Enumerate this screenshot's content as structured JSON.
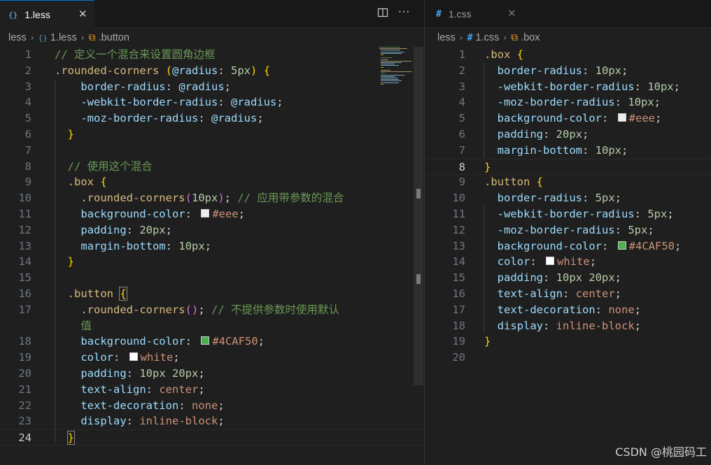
{
  "left": {
    "tab": {
      "icon": "{}",
      "label": "1.less",
      "close": "✕"
    },
    "actions": {
      "split": "split-editor-icon",
      "more": "···"
    },
    "breadcrumb": {
      "file": "less",
      "file2": "1.less",
      "symbol": ".button"
    },
    "current_line": 24,
    "lines": [
      {
        "n": "1",
        "t": [
          [
            "c-comment",
            "// 定义一个混合来设置圆角边框"
          ]
        ]
      },
      {
        "n": "2",
        "t": [
          [
            "c-sel",
            ".rounded-corners"
          ],
          [
            "c-txt",
            " "
          ],
          [
            "c-b1",
            "("
          ],
          [
            "c-var",
            "@radius"
          ],
          [
            "c-txt",
            ": "
          ],
          [
            "c-num",
            "5px"
          ],
          [
            "c-b1",
            ")"
          ],
          [
            "c-txt",
            " "
          ],
          [
            "c-b1",
            "{"
          ]
        ]
      },
      {
        "n": "3",
        "t": [
          [
            "c-txt",
            "    "
          ],
          [
            "c-prop",
            "border-radius"
          ],
          [
            "c-txt",
            ": "
          ],
          [
            "c-var",
            "@radius"
          ],
          [
            "c-txt",
            ";"
          ]
        ]
      },
      {
        "n": "4",
        "t": [
          [
            "c-txt",
            "    "
          ],
          [
            "c-prop",
            "-webkit-border-radius"
          ],
          [
            "c-txt",
            ": "
          ],
          [
            "c-var",
            "@radius"
          ],
          [
            "c-txt",
            ";"
          ]
        ]
      },
      {
        "n": "5",
        "t": [
          [
            "c-txt",
            "    "
          ],
          [
            "c-prop",
            "-moz-border-radius"
          ],
          [
            "c-txt",
            ": "
          ],
          [
            "c-var",
            "@radius"
          ],
          [
            "c-txt",
            ";"
          ]
        ]
      },
      {
        "n": "6",
        "t": [
          [
            "c-txt",
            "  "
          ],
          [
            "c-b1",
            "}"
          ]
        ]
      },
      {
        "n": "7",
        "t": []
      },
      {
        "n": "8",
        "t": [
          [
            "c-txt",
            "  "
          ],
          [
            "c-comment",
            "// 使用这个混合"
          ]
        ]
      },
      {
        "n": "9",
        "t": [
          [
            "c-txt",
            "  "
          ],
          [
            "c-sel",
            ".box"
          ],
          [
            "c-txt",
            " "
          ],
          [
            "c-b1",
            "{"
          ]
        ]
      },
      {
        "n": "10",
        "t": [
          [
            "c-txt",
            "    "
          ],
          [
            "c-sel",
            ".rounded-corners"
          ],
          [
            "c-b2",
            "("
          ],
          [
            "c-num",
            "10px"
          ],
          [
            "c-b2",
            ")"
          ],
          [
            "c-txt",
            "; "
          ],
          [
            "c-comment",
            "// 应用带参数的混合"
          ]
        ]
      },
      {
        "n": "11",
        "t": [
          [
            "c-txt",
            "    "
          ],
          [
            "c-prop",
            "background-color"
          ],
          [
            "c-txt",
            ": "
          ],
          [
            "swatch",
            "#eeeeee"
          ],
          [
            "c-str",
            "#eee"
          ],
          [
            "c-txt",
            ";"
          ]
        ]
      },
      {
        "n": "12",
        "t": [
          [
            "c-txt",
            "    "
          ],
          [
            "c-prop",
            "padding"
          ],
          [
            "c-txt",
            ": "
          ],
          [
            "c-num",
            "20px"
          ],
          [
            "c-txt",
            ";"
          ]
        ]
      },
      {
        "n": "13",
        "t": [
          [
            "c-txt",
            "    "
          ],
          [
            "c-prop",
            "margin-bottom"
          ],
          [
            "c-txt",
            ": "
          ],
          [
            "c-num",
            "10px"
          ],
          [
            "c-txt",
            ";"
          ]
        ]
      },
      {
        "n": "14",
        "t": [
          [
            "c-txt",
            "  "
          ],
          [
            "c-b1",
            "}"
          ]
        ]
      },
      {
        "n": "15",
        "t": []
      },
      {
        "n": "16",
        "t": [
          [
            "c-txt",
            "  "
          ],
          [
            "c-sel",
            ".button"
          ],
          [
            "c-txt",
            " "
          ],
          [
            "c-b1 bracket-match",
            "{"
          ]
        ]
      },
      {
        "n": "17",
        "t": [
          [
            "c-txt",
            "    "
          ],
          [
            "c-sel",
            ".rounded-corners"
          ],
          [
            "c-b2",
            "()"
          ],
          [
            "c-txt",
            "; "
          ],
          [
            "c-comment",
            "// 不提供参数时使用默认"
          ]
        ]
      },
      {
        "n": "",
        "t": [
          [
            "c-txt",
            "    "
          ],
          [
            "c-comment",
            "值"
          ]
        ]
      },
      {
        "n": "18",
        "t": [
          [
            "c-txt",
            "    "
          ],
          [
            "c-prop",
            "background-color"
          ],
          [
            "c-txt",
            ": "
          ],
          [
            "swatch",
            "#4CAF50"
          ],
          [
            "c-str",
            "#4CAF50"
          ],
          [
            "c-txt",
            ";"
          ]
        ]
      },
      {
        "n": "19",
        "t": [
          [
            "c-txt",
            "    "
          ],
          [
            "c-prop",
            "color"
          ],
          [
            "c-txt",
            ": "
          ],
          [
            "swatch",
            "#ffffff"
          ],
          [
            "c-str",
            "white"
          ],
          [
            "c-txt",
            ";"
          ]
        ]
      },
      {
        "n": "20",
        "t": [
          [
            "c-txt",
            "    "
          ],
          [
            "c-prop",
            "padding"
          ],
          [
            "c-txt",
            ": "
          ],
          [
            "c-num",
            "10px 20px"
          ],
          [
            "c-txt",
            ";"
          ]
        ]
      },
      {
        "n": "21",
        "t": [
          [
            "c-txt",
            "    "
          ],
          [
            "c-prop",
            "text-align"
          ],
          [
            "c-txt",
            ": "
          ],
          [
            "c-str",
            "center"
          ],
          [
            "c-txt",
            ";"
          ]
        ]
      },
      {
        "n": "22",
        "t": [
          [
            "c-txt",
            "    "
          ],
          [
            "c-prop",
            "text-decoration"
          ],
          [
            "c-txt",
            ": "
          ],
          [
            "c-str",
            "none"
          ],
          [
            "c-txt",
            ";"
          ]
        ]
      },
      {
        "n": "23",
        "t": [
          [
            "c-txt",
            "    "
          ],
          [
            "c-prop",
            "display"
          ],
          [
            "c-txt",
            ": "
          ],
          [
            "c-str",
            "inline-block"
          ],
          [
            "c-txt",
            ";"
          ]
        ]
      },
      {
        "n": "24",
        "t": [
          [
            "c-txt",
            "  "
          ],
          [
            "c-b1 bracket-match",
            "}"
          ]
        ]
      }
    ]
  },
  "right": {
    "tab": {
      "icon": "#",
      "label": "1.css",
      "close": "✕"
    },
    "breadcrumb": {
      "file": "less",
      "file2": "1.css",
      "symbol": ".box"
    },
    "current_line": 8,
    "lines": [
      {
        "n": "1",
        "t": [
          [
            "c-sel",
            ".box"
          ],
          [
            "c-txt",
            " "
          ],
          [
            "c-b1",
            "{"
          ]
        ]
      },
      {
        "n": "2",
        "t": [
          [
            "c-txt",
            "  "
          ],
          [
            "c-prop",
            "border-radius"
          ],
          [
            "c-txt",
            ": "
          ],
          [
            "c-num",
            "10px"
          ],
          [
            "c-txt",
            ";"
          ]
        ]
      },
      {
        "n": "3",
        "t": [
          [
            "c-txt",
            "  "
          ],
          [
            "c-prop",
            "-webkit-border-radius"
          ],
          [
            "c-txt",
            ": "
          ],
          [
            "c-num",
            "10px"
          ],
          [
            "c-txt",
            ";"
          ]
        ]
      },
      {
        "n": "4",
        "t": [
          [
            "c-txt",
            "  "
          ],
          [
            "c-prop",
            "-moz-border-radius"
          ],
          [
            "c-txt",
            ": "
          ],
          [
            "c-num",
            "10px"
          ],
          [
            "c-txt",
            ";"
          ]
        ]
      },
      {
        "n": "5",
        "t": [
          [
            "c-txt",
            "  "
          ],
          [
            "c-prop",
            "background-color"
          ],
          [
            "c-txt",
            ": "
          ],
          [
            "swatch",
            "#eeeeee"
          ],
          [
            "c-str",
            "#eee"
          ],
          [
            "c-txt",
            ";"
          ]
        ]
      },
      {
        "n": "6",
        "t": [
          [
            "c-txt",
            "  "
          ],
          [
            "c-prop",
            "padding"
          ],
          [
            "c-txt",
            ": "
          ],
          [
            "c-num",
            "20px"
          ],
          [
            "c-txt",
            ";"
          ]
        ]
      },
      {
        "n": "7",
        "t": [
          [
            "c-txt",
            "  "
          ],
          [
            "c-prop",
            "margin-bottom"
          ],
          [
            "c-txt",
            ": "
          ],
          [
            "c-num",
            "10px"
          ],
          [
            "c-txt",
            ";"
          ]
        ]
      },
      {
        "n": "8",
        "t": [
          [
            "c-b1",
            "}"
          ]
        ]
      },
      {
        "n": "9",
        "t": [
          [
            "c-sel",
            ".button"
          ],
          [
            "c-txt",
            " "
          ],
          [
            "c-b1",
            "{"
          ]
        ]
      },
      {
        "n": "10",
        "t": [
          [
            "c-txt",
            "  "
          ],
          [
            "c-prop",
            "border-radius"
          ],
          [
            "c-txt",
            ": "
          ],
          [
            "c-num",
            "5px"
          ],
          [
            "c-txt",
            ";"
          ]
        ]
      },
      {
        "n": "11",
        "t": [
          [
            "c-txt",
            "  "
          ],
          [
            "c-prop",
            "-webkit-border-radius"
          ],
          [
            "c-txt",
            ": "
          ],
          [
            "c-num",
            "5px"
          ],
          [
            "c-txt",
            ";"
          ]
        ]
      },
      {
        "n": "12",
        "t": [
          [
            "c-txt",
            "  "
          ],
          [
            "c-prop",
            "-moz-border-radius"
          ],
          [
            "c-txt",
            ": "
          ],
          [
            "c-num",
            "5px"
          ],
          [
            "c-txt",
            ";"
          ]
        ]
      },
      {
        "n": "13",
        "t": [
          [
            "c-txt",
            "  "
          ],
          [
            "c-prop",
            "background-color"
          ],
          [
            "c-txt",
            ": "
          ],
          [
            "swatch",
            "#4CAF50"
          ],
          [
            "c-str",
            "#4CAF50"
          ],
          [
            "c-txt",
            ";"
          ]
        ]
      },
      {
        "n": "14",
        "t": [
          [
            "c-txt",
            "  "
          ],
          [
            "c-prop",
            "color"
          ],
          [
            "c-txt",
            ": "
          ],
          [
            "swatch",
            "#ffffff"
          ],
          [
            "c-str",
            "white"
          ],
          [
            "c-txt",
            ";"
          ]
        ]
      },
      {
        "n": "15",
        "t": [
          [
            "c-txt",
            "  "
          ],
          [
            "c-prop",
            "padding"
          ],
          [
            "c-txt",
            ": "
          ],
          [
            "c-num",
            "10px 20px"
          ],
          [
            "c-txt",
            ";"
          ]
        ]
      },
      {
        "n": "16",
        "t": [
          [
            "c-txt",
            "  "
          ],
          [
            "c-prop",
            "text-align"
          ],
          [
            "c-txt",
            ": "
          ],
          [
            "c-str",
            "center"
          ],
          [
            "c-txt",
            ";"
          ]
        ]
      },
      {
        "n": "17",
        "t": [
          [
            "c-txt",
            "  "
          ],
          [
            "c-prop",
            "text-decoration"
          ],
          [
            "c-txt",
            ": "
          ],
          [
            "c-str",
            "none"
          ],
          [
            "c-txt",
            ";"
          ]
        ]
      },
      {
        "n": "18",
        "t": [
          [
            "c-txt",
            "  "
          ],
          [
            "c-prop",
            "display"
          ],
          [
            "c-txt",
            ": "
          ],
          [
            "c-str",
            "inline-block"
          ],
          [
            "c-txt",
            ";"
          ]
        ]
      },
      {
        "n": "19",
        "t": [
          [
            "c-b1",
            "}"
          ]
        ]
      },
      {
        "n": "20",
        "t": []
      }
    ]
  },
  "watermark": "CSDN @桃园码工"
}
